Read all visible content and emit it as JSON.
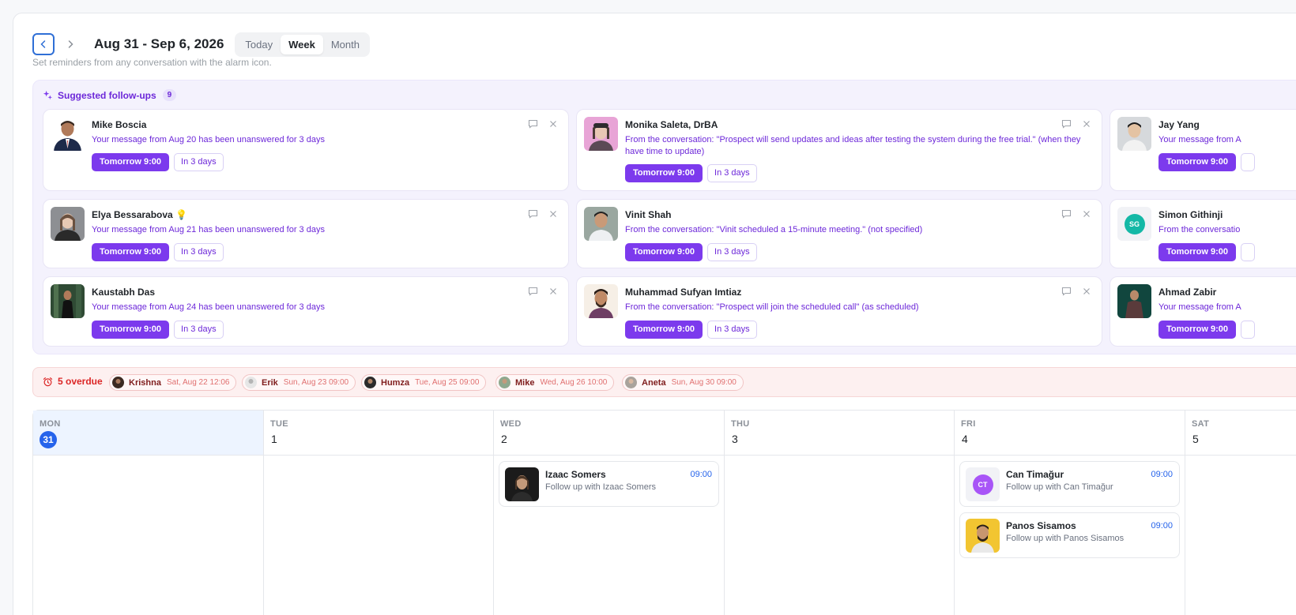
{
  "header": {
    "prev_icon": "chevron-left-icon",
    "next_icon": "chevron-right-icon",
    "range_title": "Aug 31 - Sep 6, 2026",
    "views": [
      "Today",
      "Week",
      "Month"
    ],
    "active_view": "Week",
    "hint": "Set reminders from any conversation with the alarm icon."
  },
  "suggested": {
    "title": "Suggested follow-ups",
    "count": "9",
    "icon": "sparkle-icon",
    "cards": [
      {
        "name": "Mike Boscia",
        "message": "Your message from Aug 20 has been unanswered for 3 days",
        "primary": "Tomorrow 9:00",
        "secondary": "In 3 days"
      },
      {
        "name": "Monika Saleta, DrBA",
        "message": "From the conversation: \"Prospect will send updates and ideas after testing the system during the free trial.\" (when they have time to update)",
        "primary": "Tomorrow 9:00",
        "secondary": "In 3 days"
      },
      {
        "name": "Jay Yang",
        "message": "Your message from A",
        "primary": "Tomorrow 9:00",
        "secondary": ""
      },
      {
        "name": "Elya Bessarabova 💡",
        "message": "Your message from Aug 21 has been unanswered for 3 days",
        "primary": "Tomorrow 9:00",
        "secondary": "In 3 days"
      },
      {
        "name": "Vinit Shah",
        "message": "From the conversation: \"Vinit scheduled a 15-minute meeting.\" (not specified)",
        "primary": "Tomorrow 9:00",
        "secondary": "In 3 days"
      },
      {
        "name": "Simon Githinji",
        "message": "From the conversatio",
        "primary": "Tomorrow 9:00",
        "secondary": "",
        "initials": "SG"
      },
      {
        "name": "Kaustabh Das",
        "message": "Your message from Aug 24 has been unanswered for 3 days",
        "primary": "Tomorrow 9:00",
        "secondary": "In 3 days"
      },
      {
        "name": "Muhammad Sufyan Imtiaz",
        "message": "From the conversation: \"Prospect will join the scheduled call\" (as scheduled)",
        "primary": "Tomorrow 9:00",
        "secondary": "In 3 days"
      },
      {
        "name": "Ahmad Zabir",
        "message": "Your message from A",
        "primary": "Tomorrow 9:00",
        "secondary": ""
      }
    ]
  },
  "overdue": {
    "title": "5 overdue",
    "icon": "alarm-clock-icon",
    "items": [
      {
        "name": "Krishna",
        "when": "Sat, Aug 22 12:06"
      },
      {
        "name": "Erik",
        "when": "Sun, Aug 23 09:00"
      },
      {
        "name": "Humza",
        "when": "Tue, Aug 25 09:00"
      },
      {
        "name": "Mike",
        "when": "Wed, Aug 26 10:00"
      },
      {
        "name": "Aneta",
        "when": "Sun, Aug 30 09:00"
      }
    ]
  },
  "week": {
    "days": [
      {
        "dow": "MON",
        "num": "31",
        "today": true
      },
      {
        "dow": "TUE",
        "num": "1"
      },
      {
        "dow": "WED",
        "num": "2"
      },
      {
        "dow": "THU",
        "num": "3"
      },
      {
        "dow": "FRI",
        "num": "4"
      },
      {
        "dow": "SAT",
        "num": "5"
      }
    ],
    "events": [
      {
        "day": "WED",
        "name": "Izaac Somers",
        "subtitle": "Follow up with Izaac Somers",
        "time": "09:00"
      },
      {
        "day": "FRI",
        "name": "Can Timağur",
        "subtitle": "Follow up with Can Timağur",
        "time": "09:00",
        "initials": "CT"
      },
      {
        "day": "FRI",
        "name": "Panos Sisamos",
        "subtitle": "Follow up with Panos Sisamos",
        "time": "09:00"
      }
    ]
  },
  "colors": {
    "accent_purple": "#7c3aed",
    "accent_blue": "#2563eb",
    "overdue_red": "#dc2626",
    "suggest_bg": "#f4f2fd"
  }
}
